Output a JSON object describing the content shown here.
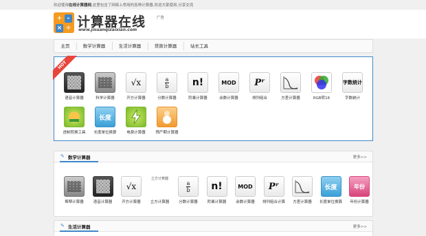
{
  "topbar": {
    "welcome_prefix": "欢迎使用",
    "site_name": "在线计算器网",
    "welcome_suffix": ",这里包含了网络上常用的各种计算器,欢迎大家使用,分享交流"
  },
  "header": {
    "logo_glyphs": [
      "+",
      "-",
      "×",
      "÷"
    ],
    "title": "计算器在线",
    "url": "www.jisuanqizaixian.com",
    "ad": "广告"
  },
  "nav": [
    "主页",
    "数学计算器",
    "生活计算器",
    "贷款计算器",
    "站长工具"
  ],
  "hot": {
    "ribbon": "HOT",
    "tools": [
      {
        "label": "语音计算器",
        "icon": "calculator-icon"
      },
      {
        "label": "科学计算器",
        "icon": "scientific-calculator-icon"
      },
      {
        "label": "开方计算器",
        "icon": "sqrt-icon",
        "glyph": "√x"
      },
      {
        "label": "分数计算器",
        "icon": "fraction-icon",
        "glyph": "a/b"
      },
      {
        "label": "阶乘计算器",
        "icon": "factorial-icon",
        "glyph": "n!"
      },
      {
        "label": "余数计算器",
        "icon": "mod-icon",
        "glyph": "MOD"
      },
      {
        "label": "排列组合",
        "icon": "permutation-icon",
        "glyph": "Pʳ"
      },
      {
        "label": "方差计算器",
        "icon": "variance-icon"
      },
      {
        "label": "RGB转16",
        "icon": "rgb-icon"
      },
      {
        "label": "字数统计",
        "icon": "word-count-icon",
        "glyph": "字数统计"
      },
      {
        "label": "进制转换工具",
        "icon": "base-convert-icon"
      },
      {
        "label": "长度单位换算",
        "icon": "length-icon",
        "glyph": "长度"
      },
      {
        "label": "电费计算器",
        "icon": "electricity-icon"
      },
      {
        "label": "预产期计算器",
        "icon": "due-date-icon"
      }
    ]
  },
  "math": {
    "title": "数学计算器",
    "more": "更多>>",
    "tools": [
      {
        "label": "帮帮计算器",
        "icon": "scientific-calculator-icon"
      },
      {
        "label": "语音计算器",
        "icon": "calculator-icon"
      },
      {
        "label": "开方计算器",
        "icon": "sqrt-icon",
        "glyph": "√x"
      },
      {
        "label": "立方计算器",
        "icon": "cube-icon",
        "alt": "立方计算器"
      },
      {
        "label": "分数计算器",
        "icon": "fraction-icon",
        "glyph": "a/b"
      },
      {
        "label": "阶乘计算器",
        "icon": "factorial-icon",
        "glyph": "n!"
      },
      {
        "label": "余数计算器",
        "icon": "mod-icon",
        "glyph": "MOD"
      },
      {
        "label": "排列组合计算",
        "icon": "permutation-icon",
        "glyph": "Pʳ"
      },
      {
        "label": "方差计算器",
        "icon": "variance-icon"
      },
      {
        "label": "长度单位换算",
        "icon": "length-icon",
        "glyph": "长度"
      },
      {
        "label": "年份计算器",
        "icon": "year-icon",
        "glyph": "年份"
      }
    ]
  },
  "life": {
    "title": "生活计算器",
    "more": "更多>>"
  },
  "colors": {
    "accent": "#3f86c8",
    "hot": "#e8453c",
    "logo": "#f39b21"
  }
}
